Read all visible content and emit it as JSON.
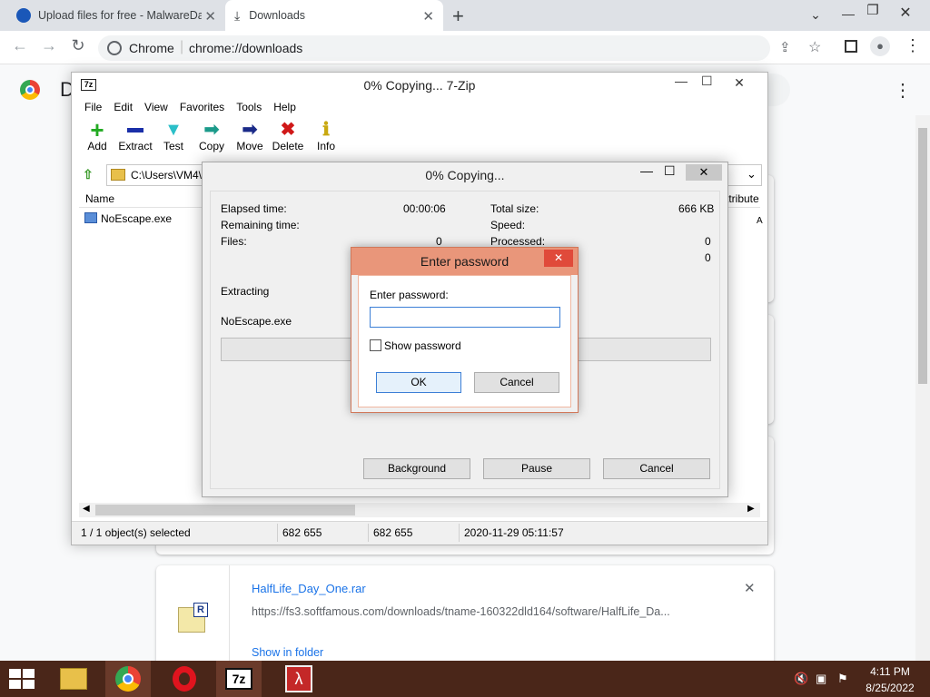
{
  "browser": {
    "tabs": [
      {
        "label": "Upload files for free - MalwareDa",
        "close": "✕"
      },
      {
        "label": "Downloads",
        "close": "✕"
      }
    ],
    "new_tab": "+",
    "omnibox": {
      "site_label": "Chrome",
      "url": "chrome://downloads"
    },
    "page_header_initial": "D",
    "menu": "⋮"
  },
  "downloads": [
    {
      "filename": "HalfLife_Day_One.rar",
      "url": "https://fs3.softfamous.com/downloads/tname-160322dld164/software/HalfLife_Da...",
      "action": "Show in folder",
      "remove": "✕"
    }
  ],
  "zip_window": {
    "title": "0% Copying... 7-Zip",
    "menu": [
      "File",
      "Edit",
      "View",
      "Favorites",
      "Tools",
      "Help"
    ],
    "toolbar": [
      {
        "label": "Add",
        "icon": "plus-icon",
        "color": "#22aa22"
      },
      {
        "label": "Extract",
        "icon": "minus-icon",
        "color": "#1a2fa8"
      },
      {
        "label": "Test",
        "icon": "check-down-icon",
        "color": "#2bbfc8"
      },
      {
        "label": "Copy",
        "icon": "arrow-right-icon",
        "color": "#1b9a8a"
      },
      {
        "label": "Move",
        "icon": "arrow-right-icon",
        "color": "#1a2a88"
      },
      {
        "label": "Delete",
        "icon": "x-icon",
        "color": "#d01818"
      },
      {
        "label": "Info",
        "icon": "info-icon",
        "color": "#e0c020"
      }
    ],
    "path": "C:\\Users\\VM4\\",
    "columns": {
      "name": "Name",
      "attributes": "ttribute"
    },
    "files": [
      {
        "name": "NoEscape.exe"
      }
    ],
    "status": {
      "selected": "1 / 1 object(s) selected",
      "size": "682 655",
      "packed": "682 655",
      "modified": "2020-11-29 05:11:57"
    }
  },
  "progress_dialog": {
    "title": "0% Copying...",
    "elapsed_label": "Elapsed time:",
    "elapsed_value": "00:00:06",
    "remaining_label": "Remaining time:",
    "files_label": "Files:",
    "files_value": "0",
    "total_size_label": "Total size:",
    "total_size_value": "666 KB",
    "speed_label": "Speed:",
    "processed_label": "Processed:",
    "processed_value": "0",
    "extra_value": "0",
    "operation": "Extracting",
    "current_file": "NoEscape.exe",
    "progress_fraction": 0,
    "buttons": {
      "background": "Background",
      "pause": "Pause",
      "cancel": "Cancel"
    }
  },
  "password_dialog": {
    "title": "Enter password",
    "prompt": "Enter password:",
    "password_value": "",
    "show_password_label": "Show password",
    "show_password_checked": false,
    "ok": "OK",
    "cancel": "Cancel",
    "close": "✕"
  },
  "taskbar": {
    "time": "4:11 PM",
    "date": "8/25/2022",
    "apps": [
      "file-explorer-icon",
      "chrome-icon",
      "opera-icon",
      "7zip-icon",
      "halflife-icon"
    ]
  }
}
